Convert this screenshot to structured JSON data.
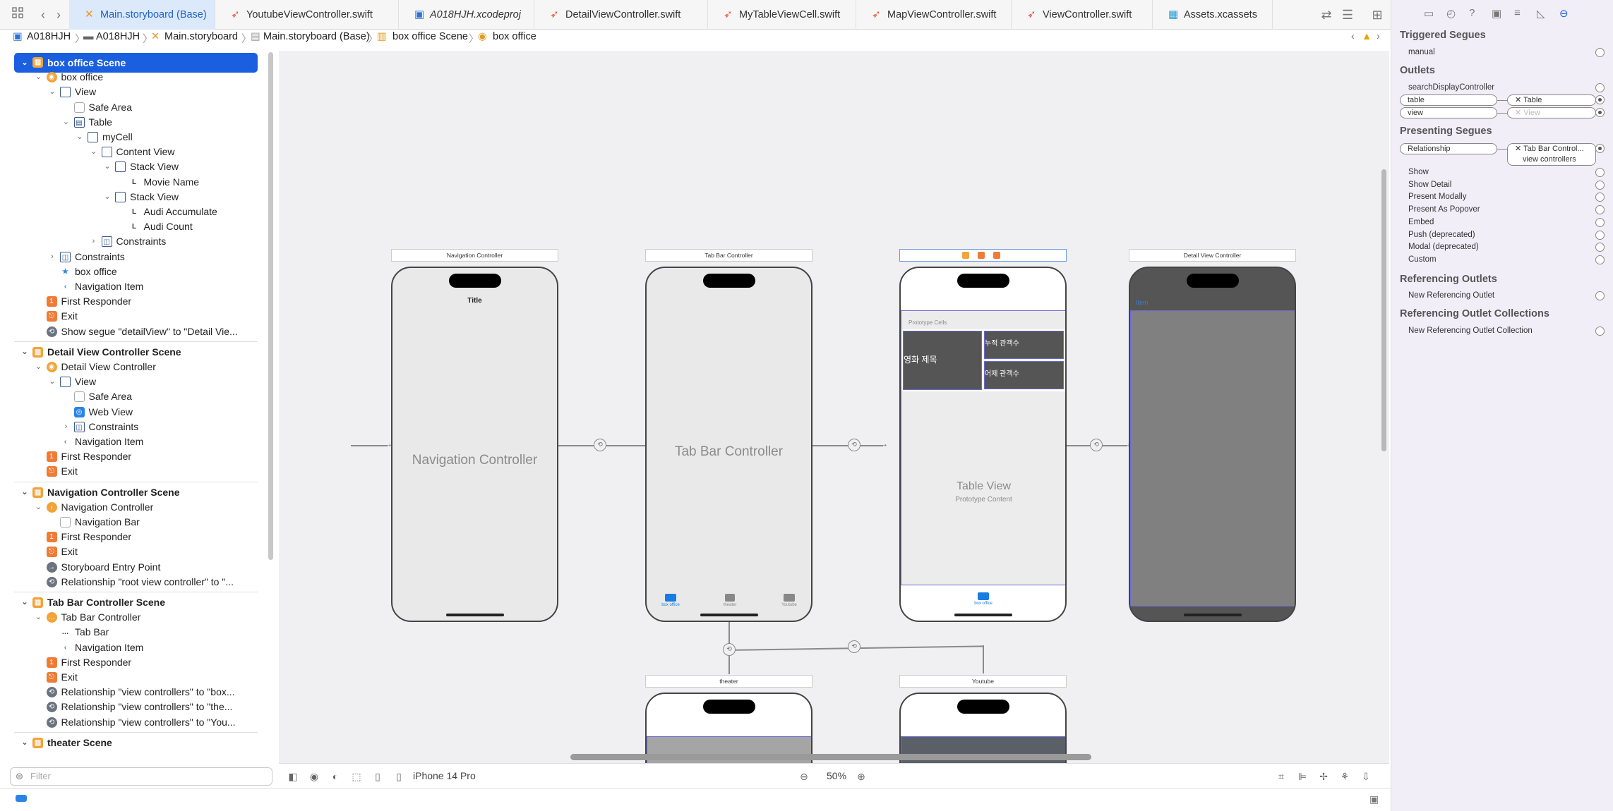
{
  "toolbar": {
    "icons": [
      "grid-icon",
      "back-icon",
      "forward-icon"
    ]
  },
  "tabs": [
    {
      "label": "Main.storyboard (Base)",
      "kind": "xib",
      "active": true
    },
    {
      "label": "YoutubeViewController.swift",
      "kind": "swift"
    },
    {
      "label": "A018HJH.xcodeproj",
      "kind": "proj"
    },
    {
      "label": "DetailViewController.swift",
      "kind": "swift"
    },
    {
      "label": "MyTableViewCell.swift",
      "kind": "swift"
    },
    {
      "label": "MapViewController.swift",
      "kind": "swift"
    },
    {
      "label": "ViewController.swift",
      "kind": "swift"
    },
    {
      "label": "Assets.xcassets",
      "kind": "asset"
    }
  ],
  "breadcrumb": [
    "A018HJH",
    "A018HJH",
    "Main.storyboard",
    "Main.storyboard (Base)",
    "box office Scene",
    "box office"
  ],
  "navigator": {
    "rows": [
      {
        "label": "box office Scene",
        "depth": 0,
        "chev": "open",
        "icon": "scene",
        "header": true,
        "selected": true
      },
      {
        "label": "box office",
        "depth": 1,
        "chev": "open",
        "icon": "vc"
      },
      {
        "label": "View",
        "depth": 2,
        "chev": "open",
        "icon": "view"
      },
      {
        "label": "Safe Area",
        "depth": 3,
        "icon": "safearea"
      },
      {
        "label": "Table",
        "depth": 3,
        "chev": "open",
        "icon": "table"
      },
      {
        "label": "myCell",
        "depth": 4,
        "chev": "open",
        "icon": "cell"
      },
      {
        "label": "Content View",
        "depth": 5,
        "chev": "open",
        "icon": "view"
      },
      {
        "label": "Stack View",
        "depth": 6,
        "chev": "open",
        "icon": "stack"
      },
      {
        "label": "Movie Name",
        "depth": 7,
        "icon": "label"
      },
      {
        "label": "Stack View",
        "depth": 6,
        "chev": "open",
        "icon": "stack"
      },
      {
        "label": "Audi Accumulate",
        "depth": 7,
        "icon": "label"
      },
      {
        "label": "Audi Count",
        "depth": 7,
        "icon": "label"
      },
      {
        "label": "Constraints",
        "depth": 5,
        "chev": "closed",
        "icon": "constraint"
      },
      {
        "label": "Constraints",
        "depth": 2,
        "chev": "closed",
        "icon": "constraint"
      },
      {
        "label": "box office",
        "depth": 2,
        "icon": "star"
      },
      {
        "label": "Navigation Item",
        "depth": 2,
        "icon": "navitem"
      },
      {
        "label": "First Responder",
        "depth": 1,
        "icon": "responder"
      },
      {
        "label": "Exit",
        "depth": 1,
        "icon": "exit"
      },
      {
        "label": "Show segue \"detailView\" to \"Detail Vie...",
        "depth": 1,
        "icon": "segue"
      },
      {
        "divider": true
      },
      {
        "label": "Detail View Controller Scene",
        "depth": 0,
        "chev": "open",
        "icon": "scene",
        "header": true
      },
      {
        "label": "Detail View Controller",
        "depth": 1,
        "chev": "open",
        "icon": "vc"
      },
      {
        "label": "View",
        "depth": 2,
        "chev": "open",
        "icon": "view"
      },
      {
        "label": "Safe Area",
        "depth": 3,
        "icon": "safearea"
      },
      {
        "label": "Web View",
        "depth": 3,
        "icon": "webview"
      },
      {
        "label": "Constraints",
        "depth": 3,
        "chev": "closed",
        "icon": "constraint"
      },
      {
        "label": "Navigation Item",
        "depth": 2,
        "icon": "navitem"
      },
      {
        "label": "First Responder",
        "depth": 1,
        "icon": "responder"
      },
      {
        "label": "Exit",
        "depth": 1,
        "icon": "exit"
      },
      {
        "divider": true
      },
      {
        "label": "Navigation Controller Scene",
        "depth": 0,
        "chev": "open",
        "icon": "scene",
        "header": true
      },
      {
        "label": "Navigation Controller",
        "depth": 1,
        "chev": "open",
        "icon": "navvc"
      },
      {
        "label": "Navigation Bar",
        "depth": 2,
        "icon": "navbar"
      },
      {
        "label": "First Responder",
        "depth": 1,
        "icon": "responder"
      },
      {
        "label": "Exit",
        "depth": 1,
        "icon": "exit"
      },
      {
        "label": "Storyboard Entry Point",
        "depth": 1,
        "icon": "entry"
      },
      {
        "label": "Relationship \"root view controller\" to \"...",
        "depth": 1,
        "icon": "segue"
      },
      {
        "divider": true
      },
      {
        "label": "Tab Bar Controller Scene",
        "depth": 0,
        "chev": "open",
        "icon": "scene",
        "header": true
      },
      {
        "label": "Tab Bar Controller",
        "depth": 1,
        "chev": "open",
        "icon": "tabvc"
      },
      {
        "label": "Tab Bar",
        "depth": 2,
        "icon": "tabbar"
      },
      {
        "label": "Navigation Item",
        "depth": 2,
        "icon": "navitem"
      },
      {
        "label": "First Responder",
        "depth": 1,
        "icon": "responder"
      },
      {
        "label": "Exit",
        "depth": 1,
        "icon": "exit"
      },
      {
        "label": "Relationship \"view controllers\" to \"box...",
        "depth": 1,
        "icon": "segue"
      },
      {
        "label": "Relationship \"view controllers\" to \"the...",
        "depth": 1,
        "icon": "segue"
      },
      {
        "label": "Relationship \"view controllers\" to \"You...",
        "depth": 1,
        "icon": "segue"
      },
      {
        "divider": true
      },
      {
        "label": "theater Scene",
        "depth": 0,
        "chev": "open",
        "icon": "scene",
        "header": true
      }
    ],
    "filter_placeholder": "Filter"
  },
  "canvas": {
    "scenes": {
      "nav": {
        "title": "Navigation Controller",
        "center": "Navigation Controller",
        "nav_title": "Title"
      },
      "tab": {
        "title": "Tab Bar Controller",
        "center": "Tab Bar Controller",
        "tabs": [
          "box office",
          "theater",
          "Youtube"
        ]
      },
      "table": {
        "prototype": "Prototype Cells",
        "movie": "영화 제목",
        "acc": "누적 관객수",
        "count": "어제 관객수",
        "center": "Table View",
        "sub": "Prototype Content",
        "tab": "box office"
      },
      "detail": {
        "title": "Detail View Controller",
        "back": "Item"
      },
      "theater": {
        "title": "theater"
      },
      "youtube": {
        "title": "Youtube"
      }
    },
    "device": "iPhone 14 Pro",
    "zoom": "50%"
  },
  "inspector": {
    "triggered": {
      "title": "Triggered Segues",
      "rows": [
        "manual"
      ]
    },
    "outlets": {
      "title": "Outlets",
      "rows": [
        "searchDisplayController",
        "table",
        "view"
      ],
      "table_target": "Table",
      "view_target": "View"
    },
    "presenting": {
      "title": "Presenting Segues",
      "relationship": "Relationship",
      "target1": "Tab Bar Control...",
      "target2": "view controllers",
      "rows": [
        "Show",
        "Show Detail",
        "Present Modally",
        "Present As Popover",
        "Embed",
        "Push (deprecated)",
        "Modal (deprecated)",
        "Custom"
      ]
    },
    "referencing": {
      "title": "Referencing Outlets",
      "row": "New Referencing Outlet"
    },
    "collections": {
      "title": "Referencing Outlet Collections",
      "row": "New Referencing Outlet Collection"
    }
  },
  "colors": {
    "accent": "#1a5fe0",
    "canvas": "#f0eff1",
    "inspector": "#f1eef8"
  }
}
